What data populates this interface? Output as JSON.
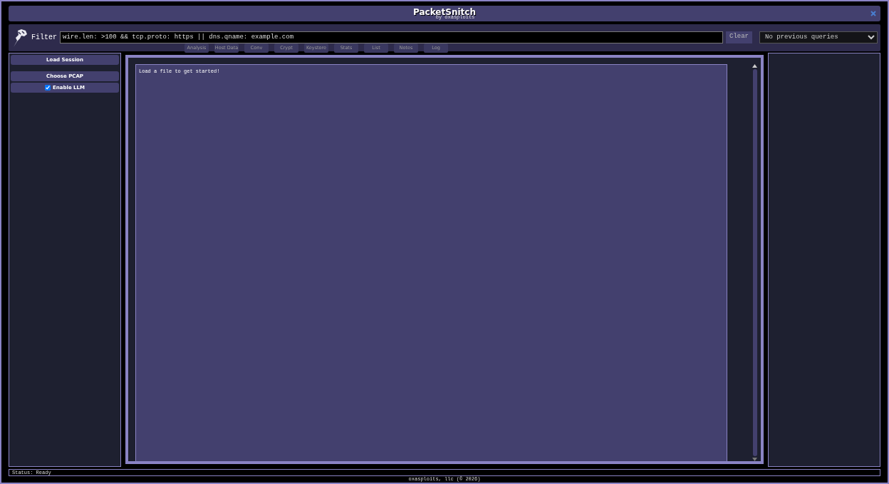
{
  "window": {
    "title": "PacketSnitch",
    "subtitle": "by oxasploits"
  },
  "filter": {
    "label": "Filter",
    "value": "wire.len: >100 && tcp.proto: https || dns.qname: example.com",
    "clear": "Clear",
    "history": "No previous queries"
  },
  "tabs": [
    {
      "label": "Analysis",
      "selected": false
    },
    {
      "label": "Host Data",
      "selected": false
    },
    {
      "label": "Conv",
      "selected": false
    },
    {
      "label": "Crypt",
      "selected": false
    },
    {
      "label": "Keystore",
      "selected": false
    },
    {
      "label": "Stats",
      "selected": false
    },
    {
      "label": "List",
      "selected": false
    },
    {
      "label": "Notes",
      "selected": false
    },
    {
      "label": "Log",
      "selected": false
    }
  ],
  "sidebar": {
    "load_session": "Load Session",
    "choose_pcap": "Choose PCAP",
    "enable_llm": {
      "label": "Enable LLM",
      "checked": true
    }
  },
  "output": {
    "text": "Load a file to get started!"
  },
  "status_bar": "Status: Ready",
  "footer": "oxasploits, llc (© 2026)"
}
